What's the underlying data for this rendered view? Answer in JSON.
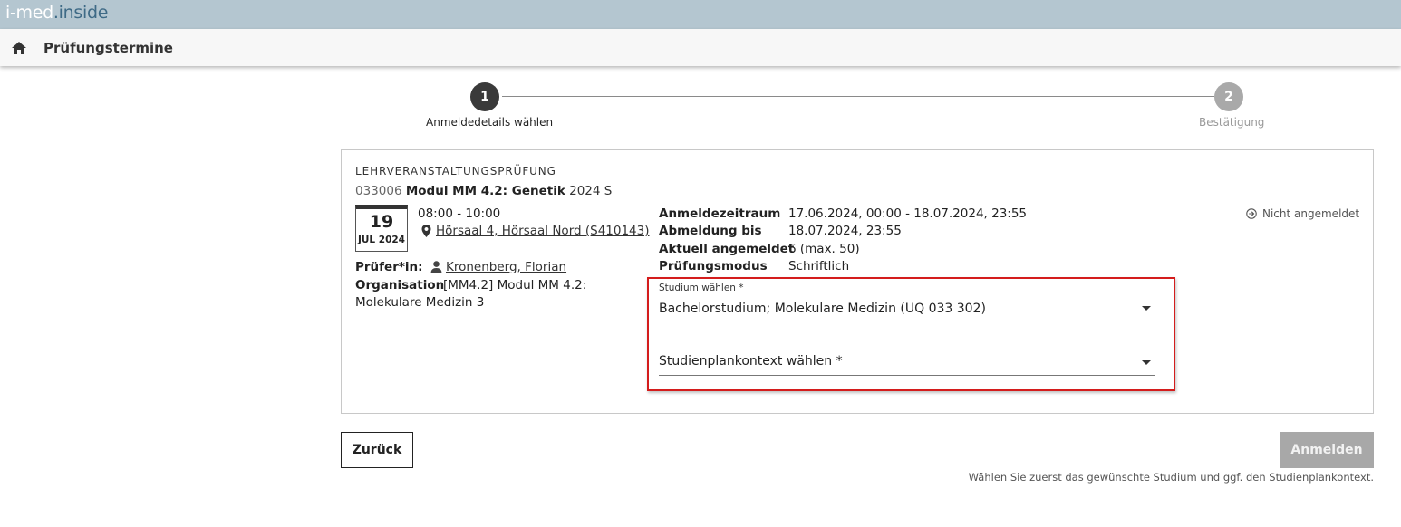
{
  "brand": {
    "part1": "i-med",
    "part2": ".inside"
  },
  "header": {
    "title": "Prüfungstermine"
  },
  "stepper": {
    "steps": [
      {
        "number": "1",
        "label": "Anmeldedetails wählen"
      },
      {
        "number": "2",
        "label": "Bestätigung"
      }
    ]
  },
  "exam": {
    "category": "LEHRVERANSTALTUNGSPRÜFUNG",
    "course_number": "033006",
    "course_title": "Modul MM 4.2: Genetik",
    "semester": "2024 S",
    "date_day": "19",
    "date_month_year": "JUL 2024",
    "time": "08:00 - 10:00",
    "location": "Hörsaal 4, Hörsaal Nord (S410143)",
    "examiner_label": "Prüfer*in:",
    "examiner": "Kronenberg, Florian",
    "organisation_label": "Organisation",
    "organisation_line1": "[MM4.2] Modul MM 4.2:",
    "organisation_line2": "Molekulare Medizin 3",
    "details": [
      {
        "label": "Anmeldezeitraum",
        "value": "17.06.2024, 00:00 - 18.07.2024, 23:55"
      },
      {
        "label": "Abmeldung bis",
        "value": "18.07.2024, 23:55"
      },
      {
        "label": "Aktuell angemeldet",
        "value": "6 (max. 50)"
      },
      {
        "label": "Prüfungsmodus",
        "value": "Schriftlich"
      }
    ],
    "status": "Nicht angemeldet"
  },
  "form": {
    "studium_label": "Studium wählen *",
    "studium_value": "Bachelorstudium; Molekulare Medizin (UQ 033 302)",
    "studienplan_placeholder": "Studienplankontext wählen *"
  },
  "actions": {
    "back_label": "Zurück",
    "submit_label": "Anmelden",
    "hint": "Wählen Sie zuerst das gewünschte Studium und ggf. den Studienplankontext."
  },
  "colors": {
    "brandbar": "#b4c6d0",
    "highlight_border": "#d41c1c",
    "disabled_button": "#a8a8a8"
  }
}
